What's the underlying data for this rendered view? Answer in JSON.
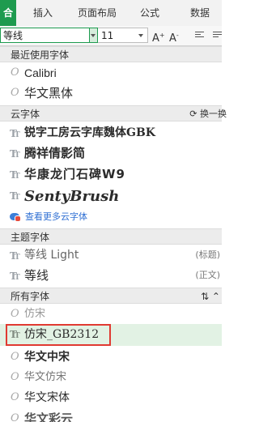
{
  "ribbon": {
    "tabs": [
      {
        "label": "合",
        "active": true
      },
      {
        "label": "插入"
      },
      {
        "label": "页面布局"
      },
      {
        "label": "公式"
      },
      {
        "label": "数据"
      }
    ]
  },
  "toolbar": {
    "font_value": "等线",
    "size_value": "11",
    "grow_label": "A",
    "shrink_label": "A",
    "grow_glyph": "+",
    "shrink_glyph": "-"
  },
  "dropdown": {
    "recent": {
      "header": "最近使用字体",
      "fonts": [
        "Calibri",
        "华文黑体"
      ]
    },
    "cloud": {
      "header": "云字体",
      "swap_label": "换一换",
      "fonts": [
        "锐字工房云字库魏体GBK",
        "腾祥倩影简",
        "华康龙门石碑W9",
        "SentyBrush"
      ],
      "more_link": "查看更多云字体"
    },
    "theme": {
      "header": "主题字体",
      "fonts": [
        {
          "name": "等线 Light",
          "tag": "(标题)"
        },
        {
          "name": "等线",
          "tag": "(正文)"
        }
      ]
    },
    "all": {
      "header": "所有字体",
      "fonts": [
        "仿宋",
        "仿宋_GB2312",
        "华文中宋",
        "华文仿宋",
        "华文宋体",
        "华文彩云"
      ],
      "selected": "仿宋_GB2312"
    }
  },
  "colors": {
    "accent": "#1e9b4f",
    "selection_highlight": "#e03a32",
    "link": "#2f6fd3"
  }
}
